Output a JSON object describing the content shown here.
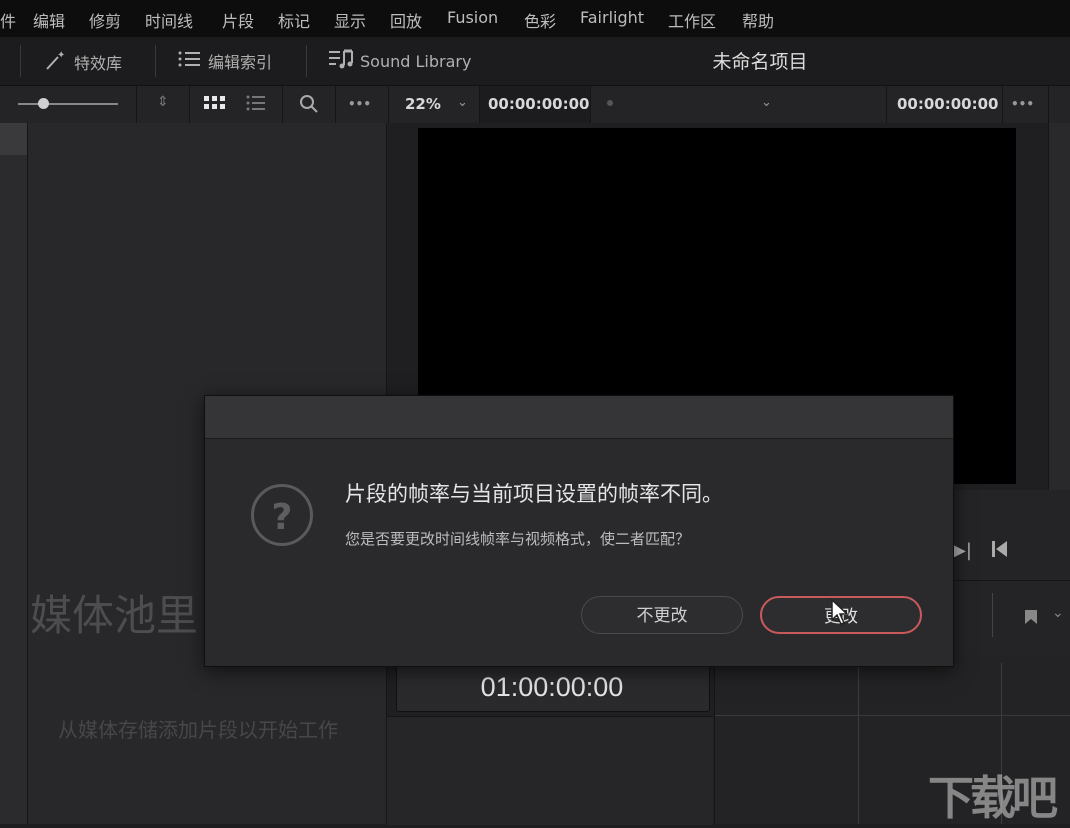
{
  "menu": {
    "items": [
      "件",
      "编辑",
      "修剪",
      "时间线",
      "片段",
      "标记",
      "显示",
      "回放",
      "Fusion",
      "色彩",
      "Fairlight",
      "工作区",
      "帮助"
    ]
  },
  "toolbar": {
    "effects_label": "特效库",
    "edit_index_label": "编辑索引",
    "sound_library_label": "Sound Library",
    "project_title": "未命名项目"
  },
  "controls": {
    "zoom_value": "22%",
    "source_timecode": "00:00:00:00",
    "record_timecode": "00:00:00:00",
    "more_label": "•••"
  },
  "media_pool": {
    "empty_title": "媒体池里",
    "empty_hint": "从媒体存储添加片段以开始工作"
  },
  "viewer": {
    "timecode": "01:00:00:00"
  },
  "dialog": {
    "title": "片段的帧率与当前项目设置的帧率不同。",
    "message": "您是否要更改时间线帧率与视频格式，使二者匹配？",
    "cancel_label": "不更改",
    "confirm_label": "更改"
  },
  "watermark": "下载吧",
  "colors": {
    "accent_button_border": "#c85a5c",
    "background": "#1e1e20"
  }
}
